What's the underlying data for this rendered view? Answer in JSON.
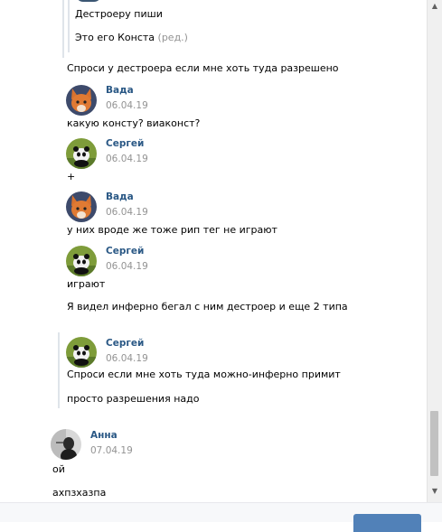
{
  "messages": {
    "q1_line1": "Дестроеру пиши",
    "q1_line2": "Это его Конста",
    "q1_edited": "(ред.)",
    "m1": "Спроси у дестроера если мне хоть туда разрешено",
    "vada_name": "Вада",
    "vada_date1": "06.04.19",
    "m2": "какую консту? виаконст?",
    "sergey_name": "Сергей",
    "sergey_date1": "06.04.19",
    "m3": "+",
    "vada_date2": "06.04.19",
    "m4": "у них вроде же тоже рип тег не играют",
    "sergey_date2": "06.04.19",
    "m5": "играют",
    "m6": "Я видел инферно бегал с ним дестроер и еще 2 типа",
    "sergey_date3": "06.04.19",
    "m7": "Спроси если мне хоть туда можно-инферно примит",
    "m8": "просто разрешения надо",
    "anna_name": "Анна",
    "anna_date": "07.04.19",
    "m9": "ой",
    "m10": "ахпзхазпа"
  },
  "scrollbar": {
    "up_icon": "triangle-up",
    "down_icon": "triangle-down"
  },
  "footer": {
    "send_label": ""
  },
  "colors": {
    "link": "#2a5885",
    "date": "#939393",
    "quote_bar": "#dfe4ea",
    "button": "#5181b8"
  }
}
